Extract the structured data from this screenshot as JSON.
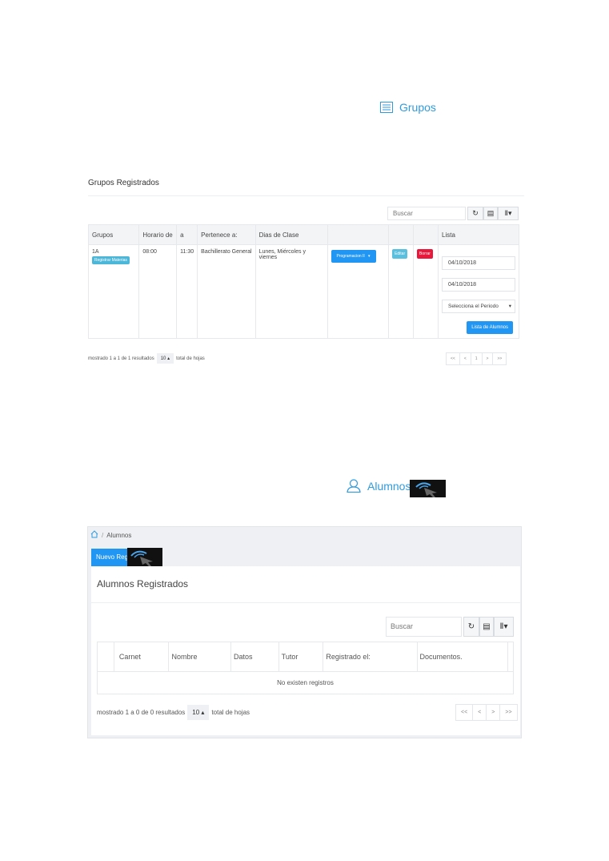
{
  "section_groups": {
    "title": "Grupos",
    "panel_title": "Grupos Registrados",
    "search_placeholder": "Buscar",
    "toolbar": {
      "refresh_icon": "refresh-icon",
      "list_icon": "list-icon",
      "columns_icon": "columns-icon"
    },
    "table": {
      "headers": [
        "Grupos",
        "Horario de",
        "a",
        "Pertenece a:",
        "Dias de Clase",
        "",
        "",
        "",
        "Lista"
      ],
      "row": {
        "grupo": "1A",
        "registrar_label": "Registrar Materias",
        "horario_de": "08:00",
        "horario_a": "11:30",
        "pertenece": "Bachillerato General",
        "dias": "Lunes, Miércoles y viernes",
        "programacion_label": "Programacion II",
        "editar_label": "Editar",
        "borrar_label": "Borrar",
        "fecha_inicio": "04/10/2018",
        "fecha_fin": "04/10/2018",
        "periodo_label": "Selecciona el Periodo",
        "lista_button": "Lista de Alumnos"
      }
    },
    "footer": {
      "mostrado": "mostrado 1 a 1 de 1 resultados",
      "per_page": "10",
      "total": "total de hojas",
      "pager": [
        "<<",
        "<",
        "1",
        ">",
        ">>"
      ]
    }
  },
  "section_alumnos": {
    "title": "Alumnos",
    "breadcrumb": {
      "current": "Alumnos",
      "separator": "/"
    },
    "nuevo_button": "Nuevo Regis",
    "panel_title": "Alumnos Registrados",
    "search_placeholder": "Buscar",
    "table": {
      "headers": [
        "",
        "Carnet",
        "Nombre",
        "Datos",
        "Tutor",
        "Registrado el:",
        "Documentos.",
        ""
      ],
      "empty_message": "No existen registros"
    },
    "footer": {
      "mostrado": "mostrado 1 a 0 de 0 resultados",
      "per_page": "10",
      "total": "total de hojas",
      "pager": [
        "<<",
        "<",
        ">",
        ">>"
      ]
    }
  },
  "colors": {
    "accent": "#2f9be0",
    "primary_button": "#2196f3",
    "danger": "#e8173b",
    "info": "#5bc0de"
  }
}
